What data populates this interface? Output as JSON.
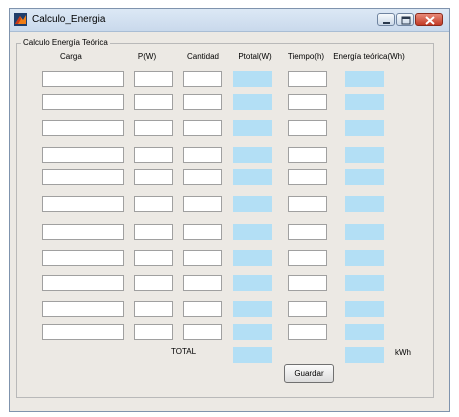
{
  "window": {
    "title": "Calculo_Energia",
    "buttons": [
      "minimize",
      "maximize",
      "close"
    ],
    "app_icon": "matlab-icon"
  },
  "panel": {
    "title": "Calculo Energía Teórica",
    "headers": {
      "carga": "Carga",
      "potencia": "P(W)",
      "cantidad": "Cantidad",
      "ptotal": "Ptotal(W)",
      "tiempo": "Tiempo(h)",
      "energia": "Energía teórica(Wh)"
    },
    "rows": [
      {
        "carga": "",
        "potencia": "",
        "cantidad": "",
        "ptotal": "",
        "tiempo": "",
        "energia": ""
      },
      {
        "carga": "",
        "potencia": "",
        "cantidad": "",
        "ptotal": "",
        "tiempo": "",
        "energia": ""
      },
      {
        "carga": "",
        "potencia": "",
        "cantidad": "",
        "ptotal": "",
        "tiempo": "",
        "energia": ""
      },
      {
        "carga": "",
        "potencia": "",
        "cantidad": "",
        "ptotal": "",
        "tiempo": "",
        "energia": ""
      },
      {
        "carga": "",
        "potencia": "",
        "cantidad": "",
        "ptotal": "",
        "tiempo": "",
        "energia": ""
      },
      {
        "carga": "",
        "potencia": "",
        "cantidad": "",
        "ptotal": "",
        "tiempo": "",
        "energia": ""
      },
      {
        "carga": "",
        "potencia": "",
        "cantidad": "",
        "ptotal": "",
        "tiempo": "",
        "energia": ""
      },
      {
        "carga": "",
        "potencia": "",
        "cantidad": "",
        "ptotal": "",
        "tiempo": "",
        "energia": ""
      },
      {
        "carga": "",
        "potencia": "",
        "cantidad": "",
        "ptotal": "",
        "tiempo": "",
        "energia": ""
      },
      {
        "carga": "",
        "potencia": "",
        "cantidad": "",
        "ptotal": "",
        "tiempo": "",
        "energia": ""
      },
      {
        "carga": "",
        "potencia": "",
        "cantidad": "",
        "ptotal": "",
        "tiempo": "",
        "energia": ""
      }
    ],
    "total_label": "TOTAL",
    "total_ptotal": "",
    "total_energia": "",
    "unit_label": "kWh",
    "save_label": "Guardar"
  },
  "colors": {
    "output_field": "#b3dff5",
    "window_bg": "#ece9e4",
    "close_button": "#c23a25"
  }
}
